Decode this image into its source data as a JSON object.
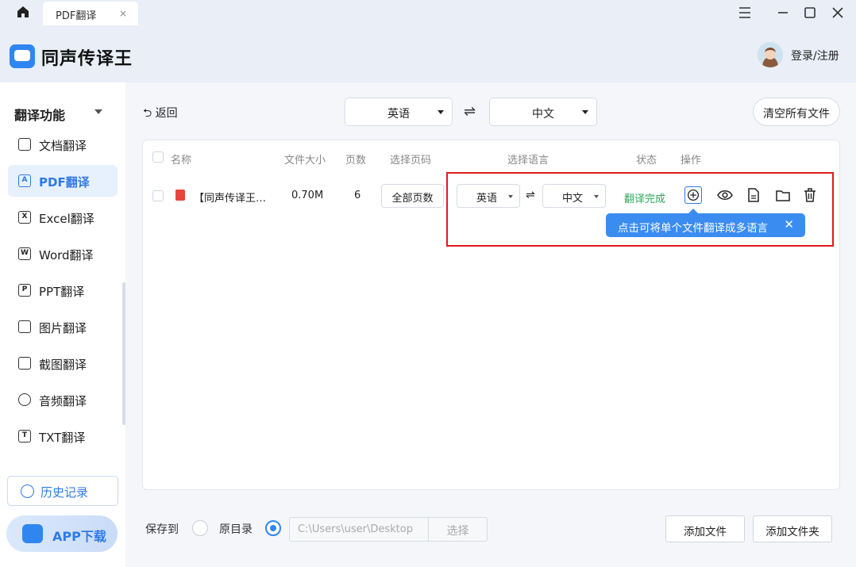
{
  "titlebar": {
    "tab_label": "PDF翻译",
    "tab_close": "×"
  },
  "header": {
    "app_name": "同声传译王",
    "login_label": "登录/注册"
  },
  "sidebar": {
    "section_title": "翻译功能",
    "items": [
      {
        "label": "文档翻译",
        "icon": "document-icon",
        "glyph": ""
      },
      {
        "label": "PDF翻译",
        "icon": "pdf-icon",
        "glyph": "A"
      },
      {
        "label": "Excel翻译",
        "icon": "excel-icon",
        "glyph": "X"
      },
      {
        "label": "Word翻译",
        "icon": "word-icon",
        "glyph": "W"
      },
      {
        "label": "PPT翻译",
        "icon": "ppt-icon",
        "glyph": "P"
      },
      {
        "label": "图片翻译",
        "icon": "image-icon",
        "glyph": ""
      },
      {
        "label": "截图翻译",
        "icon": "screenshot-icon",
        "glyph": ""
      },
      {
        "label": "音频翻译",
        "icon": "audio-icon",
        "glyph": ""
      },
      {
        "label": "TXT翻译",
        "icon": "txt-icon",
        "glyph": "T"
      }
    ],
    "history_label": "历史记录",
    "app_download_label": "APP下载"
  },
  "toolbar": {
    "back_label": "返回",
    "source_lang": "英语",
    "target_lang": "中文",
    "swap_symbol": "⇌",
    "clear_label": "清空所有文件"
  },
  "table": {
    "headers": {
      "name": "名称",
      "size": "文件大小",
      "pages": "页数",
      "page_select": "选择页码",
      "lang_select": "选择语言",
      "status": "状态",
      "actions": "操作"
    },
    "rows": [
      {
        "name": "【同声传译王…",
        "size": "0.70M",
        "pages": "6",
        "page_btn": "全部页数",
        "src": "英语",
        "tgt": "中文",
        "swap": "⇌",
        "status": "翻译完成"
      }
    ],
    "tooltip": "点击可将单个文件翻译成多语言",
    "tooltip_close": "✕"
  },
  "footer": {
    "save_to_label": "保存到",
    "orig_dir_label": "原目录",
    "path_placeholder": "C:\\Users\\user\\Desktop",
    "choose_label": "选择",
    "add_file_label": "添加文件",
    "add_folder_label": "添加文件夹"
  },
  "colors": {
    "accent": "#2f7ae5",
    "success": "#2da95a",
    "highlight_border": "#e01b1b"
  }
}
